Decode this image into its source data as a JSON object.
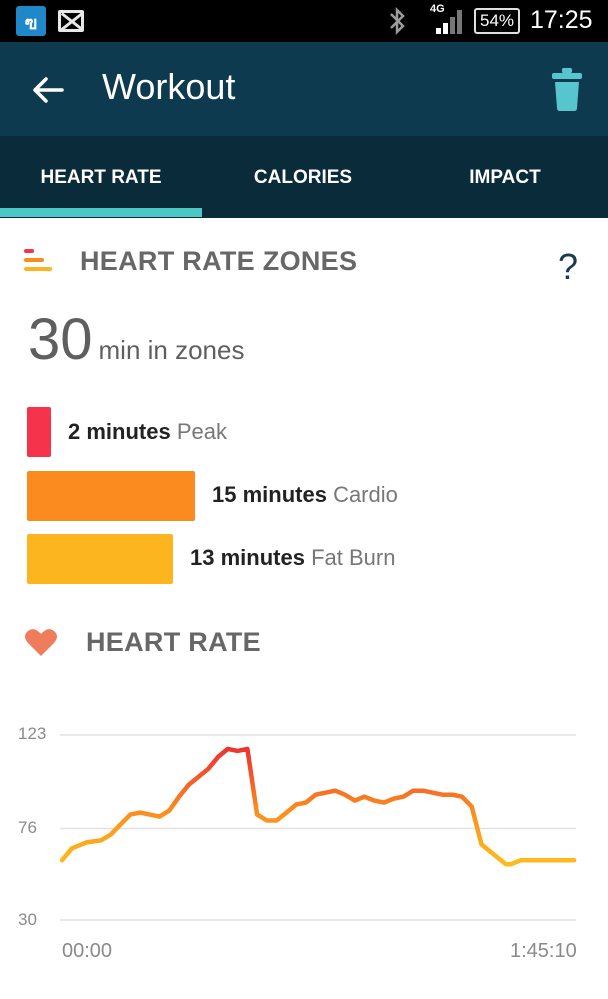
{
  "status_bar": {
    "app_icon_letter": "ฃ",
    "network": "4G",
    "battery": "54%",
    "time": "17:25"
  },
  "toolbar": {
    "title": "Workout",
    "back_icon": "arrow-left-icon",
    "delete_icon": "trash-icon"
  },
  "tabs": [
    {
      "label": "HEART RATE",
      "active": true
    },
    {
      "label": "CALORIES",
      "active": false
    },
    {
      "label": "IMPACT",
      "active": false
    }
  ],
  "zones": {
    "title": "HEART RATE ZONES",
    "help": "?",
    "total_value": "30",
    "total_unit": "min in zones",
    "items": [
      {
        "value": "2 minutes",
        "name": "Peak",
        "minutes": 2,
        "color": "#f5334a"
      },
      {
        "value": "15 minutes",
        "name": "Cardio",
        "minutes": 15,
        "color": "#fb8b1e"
      },
      {
        "value": "13 minutes",
        "name": "Fat Burn",
        "minutes": 13,
        "color": "#fdb51f"
      }
    ]
  },
  "heart_rate": {
    "title": "HEART RATE"
  },
  "chart_data": {
    "type": "line",
    "title": "",
    "xlabel": "",
    "ylabel": "",
    "x_tick_labels": [
      "00:00",
      "1:45:10"
    ],
    "y_ticks": [
      30,
      76,
      123
    ],
    "y_tick_labels": [
      "123",
      "76",
      "30"
    ],
    "ylim": [
      30,
      123
    ],
    "xlim_minutes": [
      0,
      105.17
    ],
    "grid": true,
    "series": [
      {
        "x": [
          0,
          2,
          5,
          8,
          10,
          12,
          14,
          16,
          18,
          20,
          22,
          24,
          26,
          28,
          30,
          32,
          34,
          36,
          38,
          40,
          42,
          44,
          45,
          46,
          47,
          48,
          50,
          52,
          54,
          56,
          58,
          60,
          62,
          64,
          66,
          68,
          70,
          72,
          74,
          76,
          78,
          80,
          82,
          84,
          86,
          88,
          90,
          91,
          92,
          94,
          96,
          98,
          100,
          103,
          105
        ],
        "y": [
          60,
          66,
          69,
          70,
          73,
          78,
          83,
          84,
          83,
          82,
          85,
          92,
          98,
          102,
          106,
          112,
          116,
          115,
          116,
          83,
          80,
          80,
          82,
          84,
          86,
          88,
          89,
          93,
          94,
          95,
          93,
          90,
          92,
          90,
          89,
          91,
          92,
          95,
          95,
          94,
          93,
          93,
          92,
          87,
          68,
          64,
          60,
          58,
          58,
          60,
          60,
          60,
          60,
          60,
          60
        ],
        "colors_by_level": {
          "low": "#fdd21f",
          "mid": "#fb9b2a",
          "high": "#f0442e"
        }
      }
    ]
  }
}
